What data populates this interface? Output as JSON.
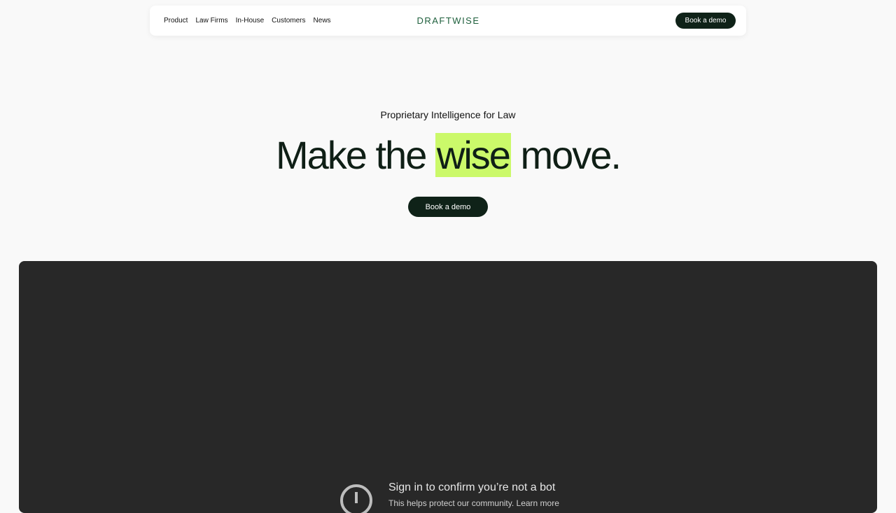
{
  "nav": {
    "links": [
      "Product",
      "Law Firms",
      "In-House",
      "Customers",
      "News"
    ],
    "logo_text": "DRAFTWISE",
    "cta_label": "Book a demo"
  },
  "hero": {
    "eyebrow": "Proprietary Intelligence for Law",
    "headline_pre": "Make the ",
    "headline_highlight": "wise",
    "headline_post": " move.",
    "cta_label": "Book a demo",
    "highlight_color": "#cbf96a",
    "button_color": "#0f2218"
  },
  "video": {
    "background_color": "#282828",
    "prompt_title": "Sign in to confirm you’re not a bot",
    "prompt_text": "This helps protect our community.",
    "prompt_link": "Learn more",
    "icon": "info-circle-icon"
  }
}
